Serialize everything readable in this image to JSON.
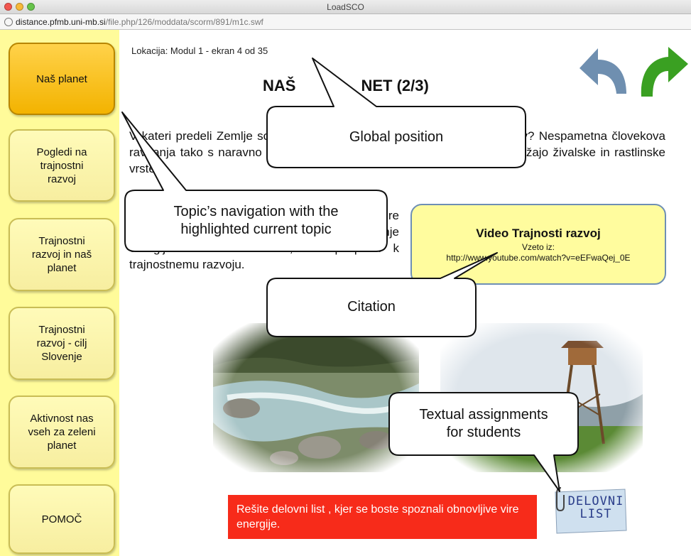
{
  "window": {
    "title": "LoadSCO",
    "url_host": "distance.pfmb.uni-mb.si",
    "url_path": "/file.php/126/moddata/scorm/891/m1c.swf"
  },
  "sidebar": {
    "items": [
      {
        "label": "Naš planet",
        "active": true
      },
      {
        "label": "Pogledi na\ntrajnostni\nrazvoj",
        "active": false
      },
      {
        "label": "Trajnostni\nrazvoj in naš\nplanet",
        "active": false
      },
      {
        "label": "Trajnostni\nrazvoj - cilj\nSlovenje",
        "active": false
      },
      {
        "label": "Aktivnost nas\nvseh za zeleni\nplanet",
        "active": false
      },
      {
        "label": "POMOČ",
        "active": false
      }
    ]
  },
  "main": {
    "location": "Lokacija: Modul 1 - ekran 4 od 35",
    "title_left": "NAŠ",
    "title_right": "NET (2/3)",
    "para1": "V kateri predeli Zemlje so ogroženi zaradi nepravilne rabe naravnih virov? Nespametna človekova ravnanja tako s naravno bogastvo in vire energije, kot zrak in vodo ogrožajo živalske in rastlinske vrste.",
    "para2": "Je pomembno, da uporabljamo obnovljivi vire energije in sodobne tehnologije za pridobivanje energije iz naravnih virov, kar prispeva k trajnostnemu razvoju.",
    "citation": {
      "title": "Video Trajnosti razvoj",
      "subtitle": "Vzeto iz:",
      "url": "http://www.youtube.com/watch?v=eEFwaQej_0E"
    },
    "assignment": "Rešite delovni list , kjer se boste spoznali obnovljive vire energije.",
    "worksheet_label": "DELOVNI\nLIST"
  },
  "callouts": {
    "global_position": "Global position",
    "topic_navigation": "Topic’s navigation with the\nhighlighted current topic",
    "citation": "Citation",
    "assignments": "Textual assignments\nfor students"
  },
  "colors": {
    "sidebar_bg": "#fffb9a",
    "active_topic": "#f7b800",
    "assignment_bg": "#f72b1a",
    "back_arrow": "#6f8fb0",
    "forward_arrow": "#3aa022"
  },
  "icons": [
    "back-arrow-icon",
    "forward-arrow-icon",
    "site-info-icon",
    "worksheet-icon"
  ]
}
